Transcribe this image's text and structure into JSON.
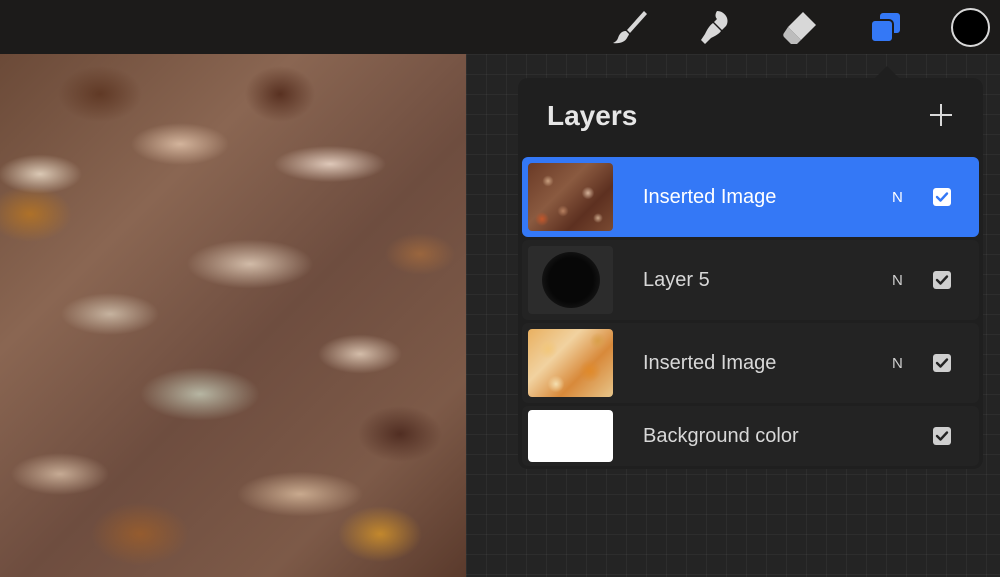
{
  "toolbar": {
    "tools": [
      {
        "name": "brush",
        "icon": "brush-icon"
      },
      {
        "name": "smudge",
        "icon": "smudge-icon"
      },
      {
        "name": "eraser",
        "icon": "eraser-icon"
      },
      {
        "name": "layers",
        "icon": "layers-icon",
        "active": true
      }
    ],
    "current_color": "#000000",
    "active_color": "#3478f6"
  },
  "layers_panel": {
    "title": "Layers",
    "add_icon": "plus-icon",
    "layers": [
      {
        "name": "Inserted Image",
        "blend_mode": "N",
        "visible": true,
        "selected": true,
        "thumbnail": "leaves-photo"
      },
      {
        "name": "Layer 5",
        "blend_mode": "N",
        "visible": true,
        "selected": false,
        "thumbnail": "black-ink-blob"
      },
      {
        "name": "Inserted Image",
        "blend_mode": "N",
        "visible": true,
        "selected": false,
        "thumbnail": "autumn-texture"
      },
      {
        "name": "Background color",
        "blend_mode": "",
        "visible": true,
        "selected": false,
        "thumbnail": "white-fill"
      }
    ]
  }
}
